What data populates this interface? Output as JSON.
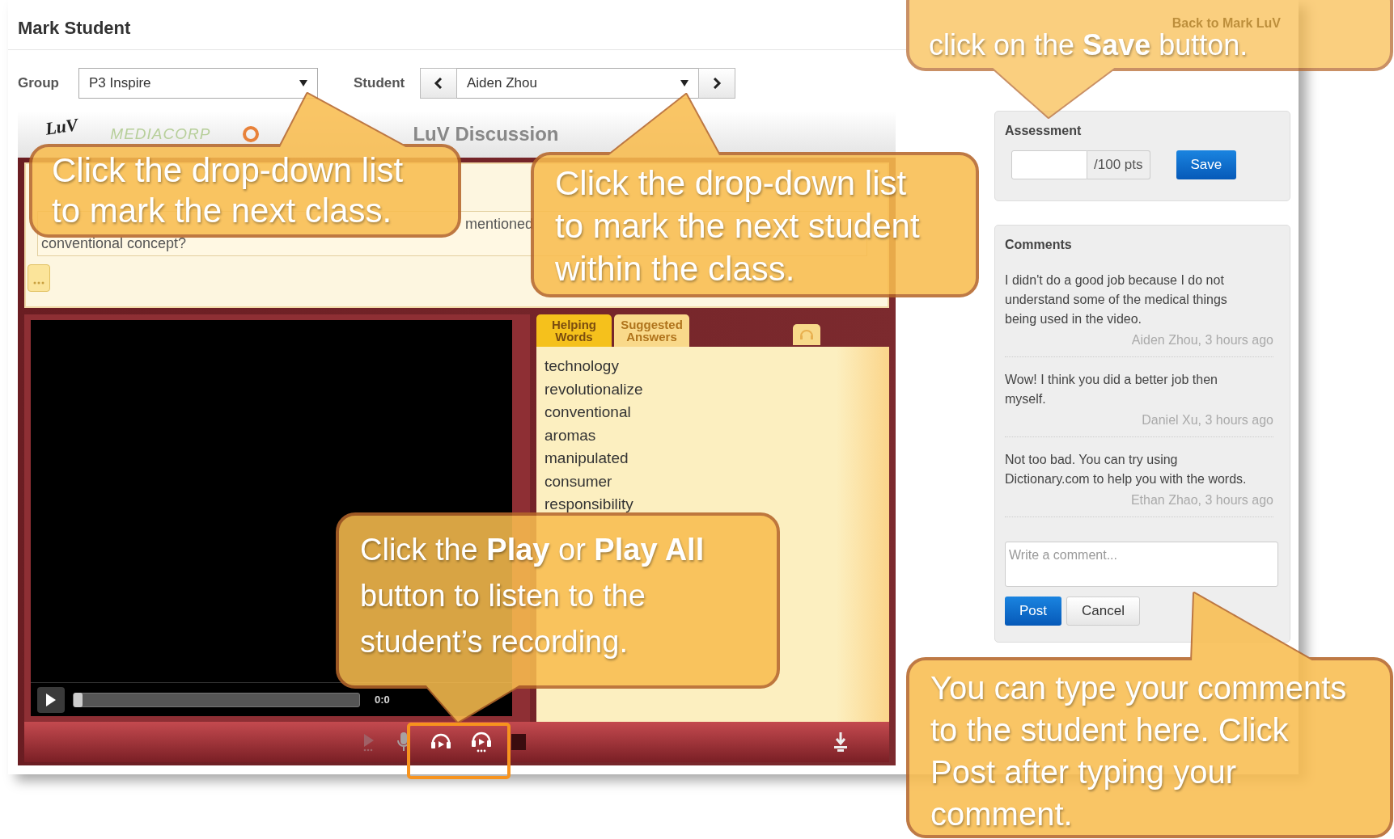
{
  "page_title": "Mark Student",
  "group": {
    "label": "Group",
    "value": "P3 Inspire"
  },
  "student": {
    "label": "Student",
    "value": "Aiden Zhou"
  },
  "player": {
    "logo_top": "LuV",
    "brand": "MEDIACORP",
    "title": "LuV Discussion",
    "prompts": {
      "question_fragments": [
        "mentioned",
        "conventional concept?"
      ]
    },
    "video": {
      "level": 0,
      "time": "0:0"
    },
    "tabs": [
      {
        "label": "Helping Words",
        "selected": true
      },
      {
        "label": "Suggested Answers",
        "selected": false
      }
    ],
    "words": [
      "technology",
      "revolutionalize",
      "conventional",
      "aromas",
      "manipulated",
      "consumer",
      "responsibility"
    ]
  },
  "back_link": "Back to Mark LuV",
  "assessment": {
    "title": "Assessment",
    "unit": "/100 pts",
    "save": "Save"
  },
  "comments": {
    "title": "Comments",
    "items": [
      {
        "text": "I didn't do a good job because I do not understand some of the medical things being used in the video.",
        "author": "Aiden Zhou, 3 hours ago"
      },
      {
        "text": "Wow! I think you did a better job then myself.",
        "author": "Daniel Xu, 3 hours ago"
      },
      {
        "text": "Not too bad. You can try using Dictionary.com to help you with the words.",
        "author": "Ethan Zhao, 3 hours ago"
      }
    ],
    "placeholder": "Write a comment...",
    "post": "Post",
    "cancel": "Cancel"
  },
  "callouts": [
    {
      "text": "Click the drop-down list to mark the next class."
    },
    {
      "text": "Click the drop-down list to mark the next student within the class."
    },
    {
      "text": "click on the **Save** button."
    },
    {
      "text": "Click the **Play** or **Play All** button to listen to the student’s recording."
    },
    {
      "text": "You can type your comments to the student here. Click Post after typing your comment."
    }
  ]
}
